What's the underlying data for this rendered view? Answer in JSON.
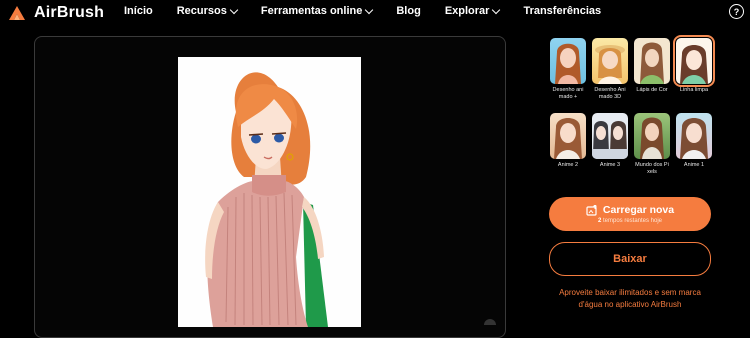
{
  "header": {
    "brand": "AirBrush",
    "help": "?",
    "menu": [
      {
        "label": "Início",
        "dropdown": false
      },
      {
        "label": "Recursos",
        "dropdown": true
      },
      {
        "label": "Ferramentas online",
        "dropdown": true
      },
      {
        "label": "Blog",
        "dropdown": false
      },
      {
        "label": "Explorar",
        "dropdown": true
      },
      {
        "label": "Transferências",
        "dropdown": false
      }
    ]
  },
  "styles": [
    {
      "label": "Desenho ani mado +",
      "selected": false
    },
    {
      "label": "Desenho Ani mado 3D",
      "selected": false
    },
    {
      "label": "Lápis de Cor",
      "selected": false
    },
    {
      "label": "Linha limpa",
      "selected": true
    },
    {
      "label": "Anime 2",
      "selected": false
    },
    {
      "label": "Anime 3",
      "selected": false
    },
    {
      "label": "Mundo dos Pi xels",
      "selected": false
    },
    {
      "label": "Anime 1",
      "selected": false
    }
  ],
  "upload": {
    "label": "Carregar nova",
    "remaining_count": "2",
    "remaining_text": "tempos restantes hoje"
  },
  "download_label": "Baixar",
  "promo_text": "Aproveite baixar ilimitados e sem marca d'água no aplicativo AirBrush",
  "colors": {
    "accent": "#f57c3f",
    "background": "#000000"
  }
}
